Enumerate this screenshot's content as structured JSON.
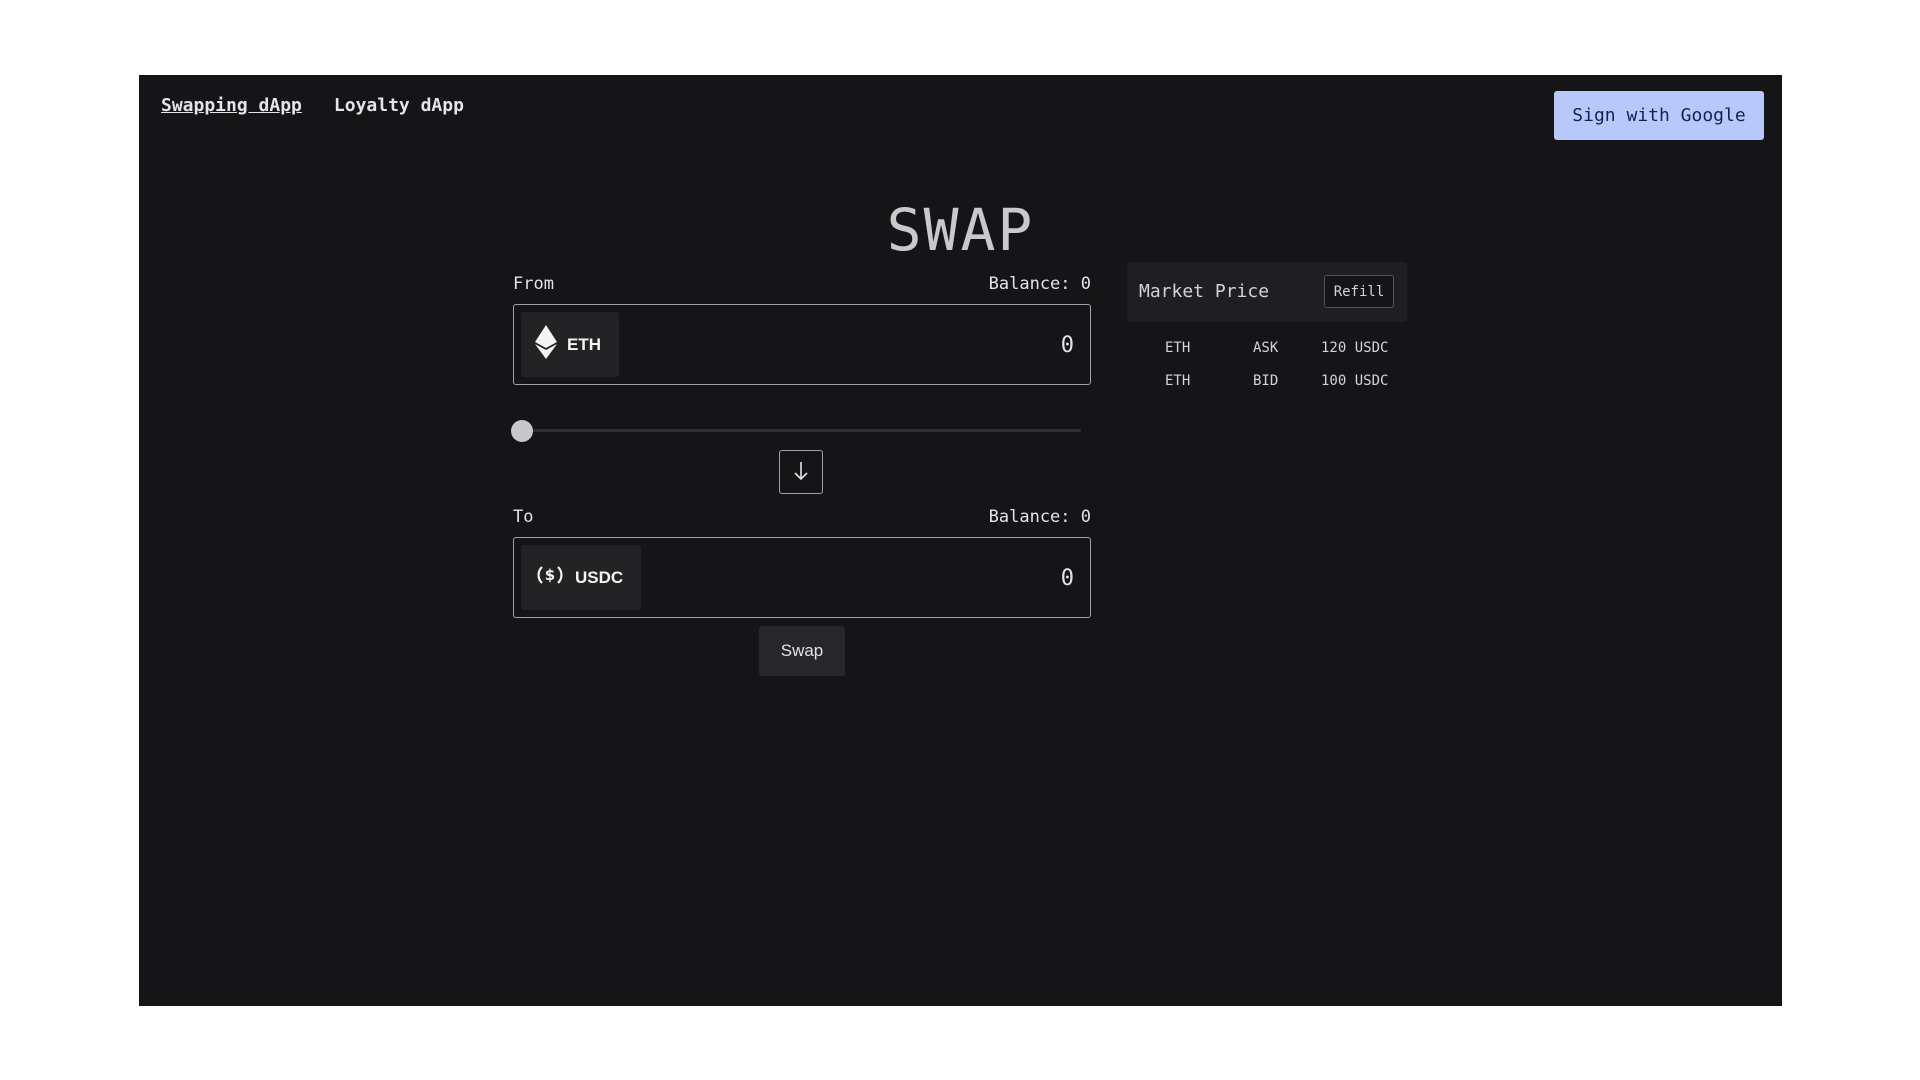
{
  "nav": {
    "items": [
      {
        "label": "Swapping dApp",
        "active": true
      },
      {
        "label": "Loyalty dApp",
        "active": false
      }
    ],
    "sign_in_label": "Sign with Google"
  },
  "title": "SWAP",
  "from": {
    "label": "From",
    "balance": "Balance: 0",
    "token": "ETH",
    "token_icon": "ethereum-icon",
    "amount": "0"
  },
  "slider": {
    "value": 0
  },
  "flip_icon": "arrow-down-icon",
  "to": {
    "label": "To",
    "balance": "Balance: 0",
    "token": "USDC",
    "token_icon": "dollar-circle-icon",
    "amount": "0"
  },
  "swap_label": "Swap",
  "market": {
    "title": "Market Price",
    "refill_label": "Refill",
    "rows": [
      {
        "asset": "ETH",
        "side": "ASK",
        "price": "120 USDC"
      },
      {
        "asset": "ETH",
        "side": "BID",
        "price": "100 USDC"
      }
    ]
  },
  "colors": {
    "background": "#151517",
    "accent": "#b9c8fb",
    "accent_text": "#14205a",
    "panel": "#1f1f22"
  }
}
